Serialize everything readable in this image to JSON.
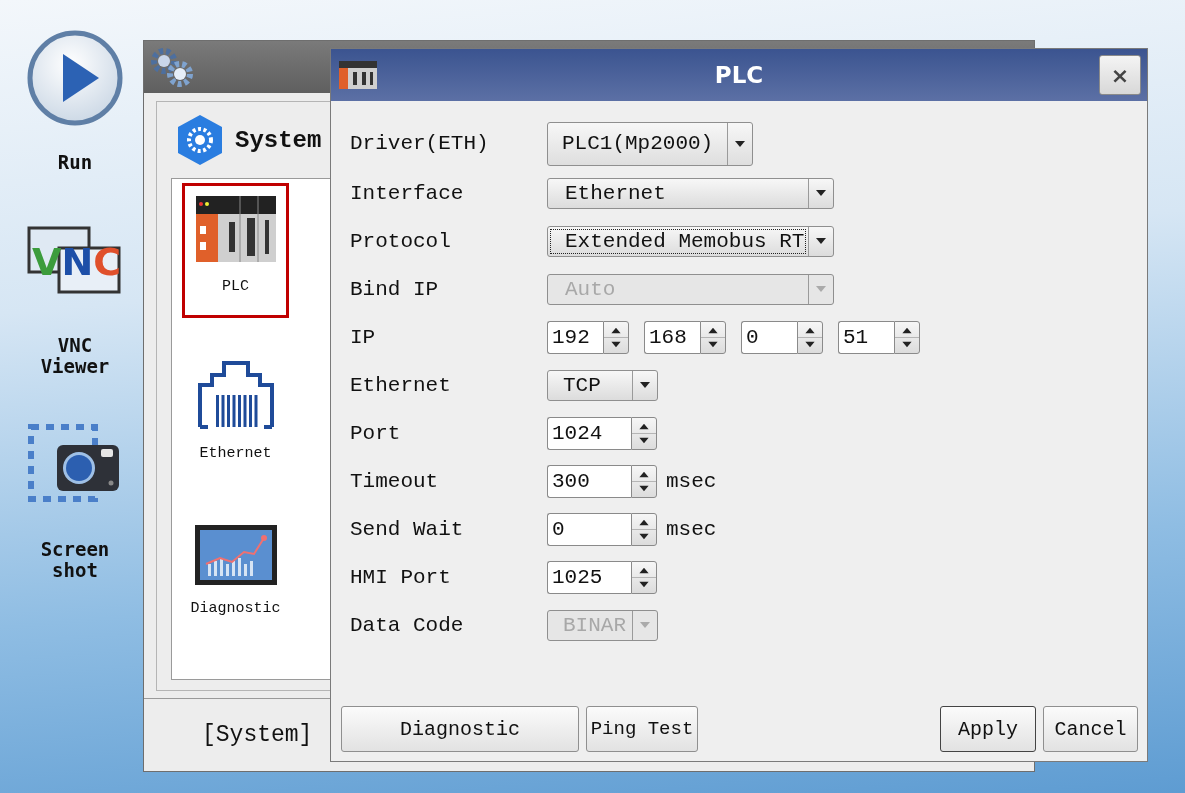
{
  "sidebar": [
    {
      "kind": "run",
      "lines": [
        "Run"
      ]
    },
    {
      "kind": "vnc",
      "lines": [
        "VNC",
        "Viewer"
      ],
      "logo": [
        {
          "char": "V",
          "color": "#3c9c3c"
        },
        {
          "char": "N",
          "color": "#1d4fa8"
        },
        {
          "char": "C",
          "color": "#e0502c"
        }
      ]
    },
    {
      "kind": "screenshot",
      "lines": [
        "Screen",
        "shot"
      ]
    }
  ],
  "system_window": {
    "header": "System",
    "items": [
      {
        "kind": "plc",
        "label": "PLC",
        "selected": true
      },
      {
        "kind": "ethernet",
        "label": "Ethernet",
        "selected": false
      },
      {
        "kind": "diagnostic",
        "label": "Diagnostic",
        "selected": false
      }
    ],
    "footer": "[System]"
  },
  "dialog": {
    "title": "PLC",
    "close": "×",
    "fields": [
      {
        "label": "Driver(ETH)",
        "kind": "driver",
        "value": "PLC1(Mp2000)"
      },
      {
        "label": "Interface",
        "kind": "select",
        "value": "Ethernet",
        "disabled": false,
        "focused": false
      },
      {
        "label": "Protocol",
        "kind": "select",
        "value": "Extended Memobus RT",
        "disabled": false,
        "focused": true
      },
      {
        "label": "Bind IP",
        "kind": "select",
        "value": "Auto",
        "disabled": true,
        "focused": false
      },
      {
        "label": "IP",
        "kind": "ip",
        "octets": [
          "192",
          "168",
          "0",
          "51"
        ]
      },
      {
        "label": "Ethernet",
        "kind": "small_select",
        "value": "TCP",
        "disabled": false
      },
      {
        "label": "Port",
        "kind": "spin",
        "value": "1024"
      },
      {
        "label": "Timeout",
        "kind": "spin",
        "value": "300",
        "unit": "msec"
      },
      {
        "label": "Send Wait",
        "kind": "spin",
        "value": "0",
        "unit": "msec"
      },
      {
        "label": "HMI Port",
        "kind": "spin",
        "value": "1025"
      },
      {
        "label": "Data Code",
        "kind": "small_select",
        "value": "BINAR",
        "disabled": true
      }
    ],
    "buttons": [
      {
        "label": "Diagnostic",
        "kind": "left",
        "default": false
      },
      {
        "label": "Ping Test",
        "kind": "left",
        "default": false
      },
      {
        "label": "Apply",
        "kind": "right",
        "default": true
      },
      {
        "label": "Cancel",
        "kind": "right",
        "default": false
      }
    ]
  }
}
